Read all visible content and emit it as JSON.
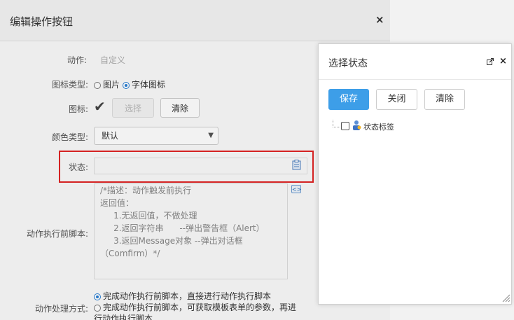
{
  "dialog": {
    "title": "编辑操作按钮",
    "close_glyph": "×",
    "action": {
      "label": "动作:",
      "value": "自定义"
    },
    "icon_type": {
      "label": "图标类型:",
      "option_image": "图片",
      "option_font": "字体图标",
      "selected": "字体图标"
    },
    "icon": {
      "label": "图标:",
      "preview_glyph": "✔",
      "select_button": "选择",
      "clear_button": "清除"
    },
    "color_type": {
      "label": "颜色类型:",
      "selected": "默认"
    },
    "state": {
      "label": "状态:",
      "value": ""
    },
    "pre_script": {
      "label": "动作执行前脚本:",
      "text": "/*描述：动作触发前执行\n返回值：\n     1.无返回值，不做处理\n     2.返回字符串      --弹出警告框（Alert）\n     3.返回Message对象 --弹出对话框\n（Comfirm）*/"
    },
    "handling": {
      "label": "动作处理方式:",
      "option_direct": "完成动作执行前脚本，直接进行动作执行脚本",
      "option_template": "完成动作执行前脚本，可获取模板表单的参数，再进行动作执行脚本",
      "selected": "option_direct"
    }
  },
  "modal": {
    "title": "选择状态",
    "buttons": {
      "save": "保存",
      "close": "关闭",
      "clear": "清除"
    },
    "tree": [
      {
        "label": "状态标签",
        "checked": false
      }
    ]
  },
  "colors": {
    "primary": "#3d9ee8",
    "highlight": "#e02424"
  },
  "icons": {
    "close": "close-icon",
    "maximize": "external-link-icon",
    "state_picker": "clipboard-icon",
    "code_editor": "code-icon",
    "tree_node": "user-group-icon",
    "resize": "resize-handle-icon"
  }
}
